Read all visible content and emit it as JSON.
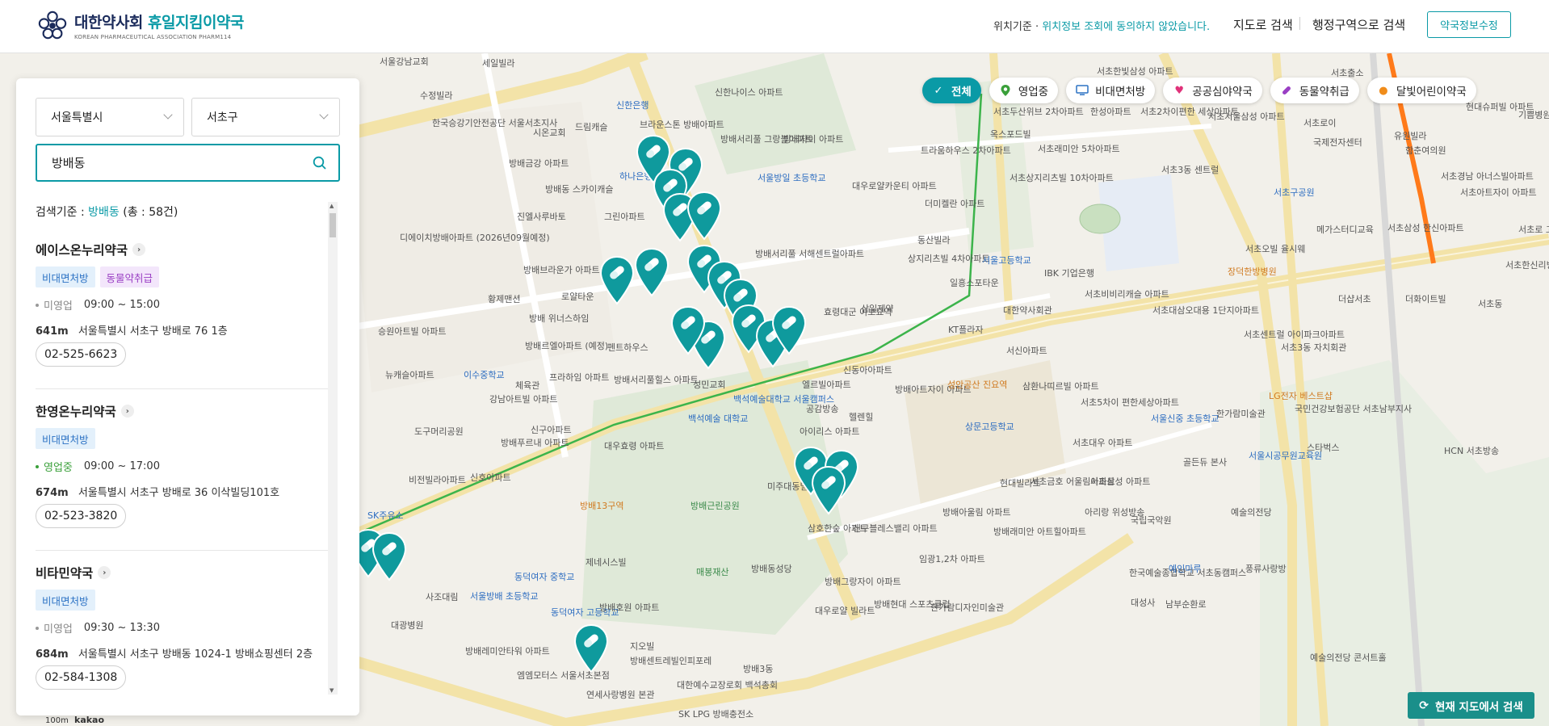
{
  "header": {
    "logo_title_a": "대한약사회",
    "logo_title_b": "휴일지킴이약국",
    "logo_sub": "KOREAN PHARMACEUTICAL ASSOCIATION PHARM114",
    "loc_prefix": "위치기준 · ",
    "loc_msg": "위치정보 조회에 동의하지 않았습니다.",
    "nav_map": "지도로 검색",
    "nav_region": "행정구역으로 검색",
    "edit_button": "약국정보수정"
  },
  "chips": [
    {
      "label": "전체",
      "icon": "check-icon",
      "active": true
    },
    {
      "label": "영업중",
      "icon": "location-pin-icon"
    },
    {
      "label": "비대면처방",
      "icon": "monitor-icon"
    },
    {
      "label": "공공심야약국",
      "icon": "heart-icon"
    },
    {
      "label": "동물약취급",
      "icon": "pill-icon"
    },
    {
      "label": "달빛어린이약국",
      "icon": "moon-icon"
    }
  ],
  "panel": {
    "city": "서울특별시",
    "district": "서초구",
    "search_value": "방배동",
    "criteria_prefix": "검색기준 : ",
    "criteria_keyword": "방배동",
    "criteria_total": "(총 : 58건)"
  },
  "pharmacies": [
    {
      "name": "에이스온누리약국",
      "tags": [
        "비대면처방",
        "동물약취급"
      ],
      "state": "미영업",
      "hours": "09:00 ~ 15:00",
      "distance": "641m",
      "address": "서울특별시 서초구 방배로 76 1층",
      "phone": "02-525-6623"
    },
    {
      "name": "한영온누리약국",
      "tags": [
        "비대면처방"
      ],
      "state": "영업중",
      "hours": "09:00 ~ 17:00",
      "distance": "674m",
      "address": "서울특별시 서초구 방배로 36 이삭빌딩101호",
      "phone": "02-523-3820"
    },
    {
      "name": "비타민약국",
      "tags": [
        "비대면처방"
      ],
      "state": "미영업",
      "hours": "09:30 ~ 13:30",
      "distance": "684m",
      "address": "서울특별시 서초구 방배동 1024-1 방배쇼핑센터 2층",
      "phone": "02-584-1308"
    }
  ],
  "map_labels": [
    "서울강남교회",
    "세일빌라",
    "수정빌라",
    "한국승강기안전공단 서울서초지사",
    "시온교회",
    "드림캐슬",
    "방배금강 아파트",
    "방배동 스카이캐슬",
    "진엘사루바토",
    "그린아파트",
    "하나은행",
    "신한은행",
    "디에이치방배아파트 (2026년09월예정)",
    "방배브라운가 아파트",
    "황제맨션",
    "로얄타운",
    "방배 위너스하임",
    "방배르엘아파트 (예정)",
    "펜트하우스",
    "승원아트빌 아파트",
    "뉴캐슬아파트",
    "이수중학교",
    "체육관",
    "프라하임 아파트",
    "방배서리풀힐스 아파트",
    "강남아트빌 아파트",
    "신구아파트",
    "도구머리공원",
    "방배푸르내 아파트",
    "비전빌라아파트",
    "신호아파트",
    "대우효령 아파트",
    "방배13구역",
    "방배근린공원",
    "SK주유소",
    "제네시스빌",
    "매봉재산",
    "동덕여자 중학교",
    "서울방배 초등학교",
    "사조대림",
    "대광병원",
    "방배레미안타워 아파트",
    "동덕여자 고등학교",
    "방배호원 아파트",
    "지오빌",
    "방배센트레빌인피포레",
    "방배3동",
    "엠엠모터스 서울서초본점",
    "연세사랑병원 본관",
    "대한예수교장로회 백석총회",
    "SK LPG 방배충전소",
    "신한나이스 아파트",
    "브라운스톤 방배아파트",
    "방배서리풀 그랑블아파트",
    "방배자이 아파트",
    "서울방일 초등학교",
    "대우로얄카운티 아파트",
    "방배서리풀 서해센트럴아파트",
    "효령대군 이보묘역",
    "삼일제약",
    "동산빌라",
    "상지리츠빌 4차아파트",
    "일흥스포타운",
    "KT플라자",
    "엘르빌아파트",
    "신동아아파트",
    "성민교회",
    "백석예술대학교 서울캠퍼스",
    "백석예술 대학교",
    "공감방송",
    "헬렌힐",
    "아이리스 아파트",
    "방배아트자이 아파트",
    "트라움하우스 2차아파트",
    "더미켈란 아파트",
    "서초한빛삼성 아파트",
    "서초두산위브 2차아파트",
    "옥스포드빌",
    "서초래미안 5차아파트",
    "서초상지리츠빌 10차아파트",
    "한성아파트",
    "서초2차이편한 세상아파트",
    "서울고등학교",
    "IBK 기업은행",
    "대한약사회관",
    "서초비비리캐슬 아파트",
    "서초대삼오대용 1단지아파트",
    "서신아파트",
    "삼환나띠르빌 아파트",
    "성안공산 진요역",
    "상문고등학교",
    "서초5차이 편한세상아파트",
    "서초대우 아파트",
    "서울신중 초등학교",
    "골든듀 본사",
    "미주대동빌딩",
    "삼호한숲 아파트",
    "방배동성당",
    "신구블레스밸리 아파트",
    "방배그랑자이 아파트",
    "대우로얄 빌라트",
    "방배현대 스포츠클럽",
    "임광1,2차 아파트",
    "방배래미안 아트힐아파트",
    "방배아울림 아파트",
    "현대빌라트",
    "서초금호 어울림아파트",
    "서초삼성 아파트",
    "아리랑 위성방송",
    "국립국악원",
    "한국예술종합학교 서초동캠퍼스",
    "예인마루",
    "풍류사랑방",
    "대성사",
    "남부순환로",
    "예술의전당 콘서트홀",
    "한가람디자인미술관",
    "예술의전당",
    "한가람미술관",
    "서울시공무원교육원",
    "국민건강보험공단 서초남부지사",
    "스타벅스",
    "HCN 서초방송",
    "서초3동 자치회관",
    "LG전자 베스트샵",
    "서초센트럴 아이파크아파트",
    "서초오빌 율시웨",
    "장덕한방병원",
    "서초서울삼성 아파트",
    "서초로이",
    "함춘여의원",
    "서초출소",
    "국제전자센터",
    "유원빌라",
    "서초경남 아너스빌아파트",
    "서초아트자이 아파트",
    "서초구공원",
    "메가스터디교육",
    "서초삼성 한신아파트",
    "현대슈퍼빌 아파트",
    "기쁨병원",
    "더샵서초",
    "더화이트빌",
    "서초동",
    "서초로 고등학교",
    "서초한신리빙 타워아파트",
    "서초3동 센트럴"
  ],
  "map_search_button": "현재 지도에서 검색",
  "scale_label": "100m",
  "kakao_label": "kakao"
}
